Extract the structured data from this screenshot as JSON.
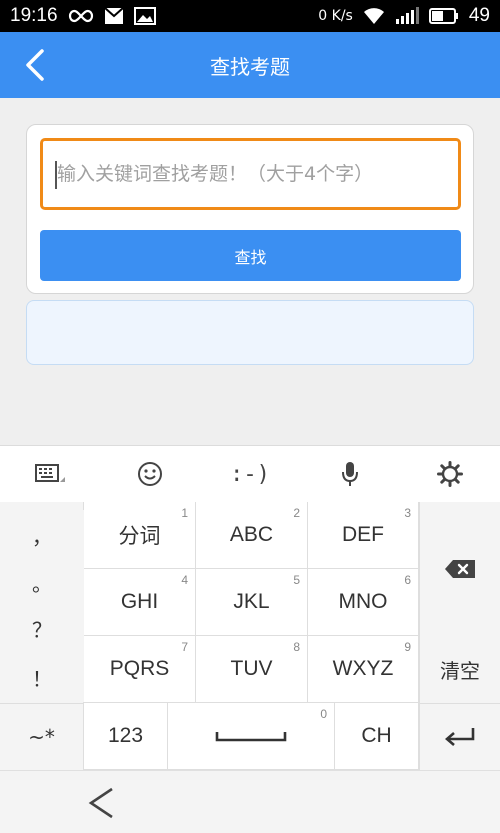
{
  "status_bar": {
    "time": "19:16",
    "net_speed": "0 K/s",
    "battery": "49"
  },
  "header": {
    "title": "查找考题"
  },
  "search": {
    "placeholder": "输入关键词查找考题！（大于4个字）",
    "value": "",
    "button_label": "查找"
  },
  "keyboard_toolbar": {
    "emoticon_label": ":-)",
    "icons": [
      "keyboard-switch-icon",
      "emoji-icon",
      "emoticon",
      "microphone-icon",
      "settings-icon"
    ]
  },
  "keyboard": {
    "punct": [
      "，",
      "。",
      "？",
      "！"
    ],
    "keys": [
      {
        "label": "分词",
        "num": "1"
      },
      {
        "label": "ABC",
        "num": "2"
      },
      {
        "label": "DEF",
        "num": "3"
      },
      {
        "label": "GHI",
        "num": "4"
      },
      {
        "label": "JKL",
        "num": "5"
      },
      {
        "label": "MNO",
        "num": "6"
      },
      {
        "label": "PQRS",
        "num": "7"
      },
      {
        "label": "TUV",
        "num": "8"
      },
      {
        "label": "WXYZ",
        "num": "9"
      }
    ],
    "clear_label": "清空",
    "symbols_label": "~*",
    "numbers_label": "123",
    "space_num": "0",
    "lang_label": "CH"
  }
}
